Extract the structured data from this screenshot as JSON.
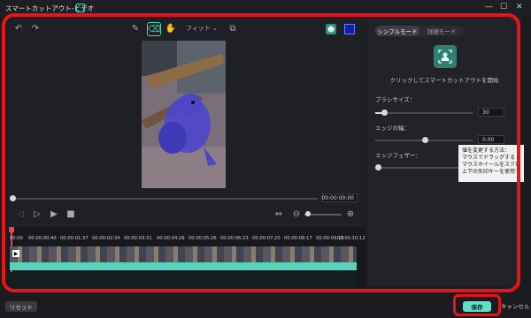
{
  "window": {
    "title": "スマートカットアウト-ビデオ",
    "minimize": "—",
    "maximize": "☐",
    "close": "✕"
  },
  "toolbar": {
    "fit_label": "フィット"
  },
  "player": {
    "time": "00:00:00:00"
  },
  "timeline": {
    "ticks": [
      "00:00",
      "00:00:00:40",
      "00:00:01:37",
      "00:00:02:34",
      "00:00:03:31",
      "00:00:04:28",
      "00:00:05:26",
      "00:00:06:23",
      "00:00:07:20",
      "00:00:08:17",
      "00:00:09:15",
      "00:00:10:12"
    ]
  },
  "panel": {
    "tabs": [
      "シンプルモード",
      "詳細モード"
    ],
    "cutout_hint": "クリックしてスマートカットアウトを開始",
    "brush_label": "ブラシサイズ：",
    "brush_value": "30",
    "brush_value_num": 30,
    "edge_width_label": "エッジの幅：",
    "edge_width_value": "0.00",
    "edge_feather_label": "エッジフェザー：",
    "tooltip_lines": [
      "値を変更する方法：",
      "マウスでドラッグする",
      "マウスホイールをスクロールする",
      "上下の矢印キーを使用する"
    ]
  },
  "footer": {
    "reset": "リセット",
    "save": "保存",
    "cancel": "キャンセル"
  },
  "colors": {
    "accent": "#5fe0c8",
    "highlight": "#e8141a",
    "preview_mask": "#4d46c9"
  }
}
